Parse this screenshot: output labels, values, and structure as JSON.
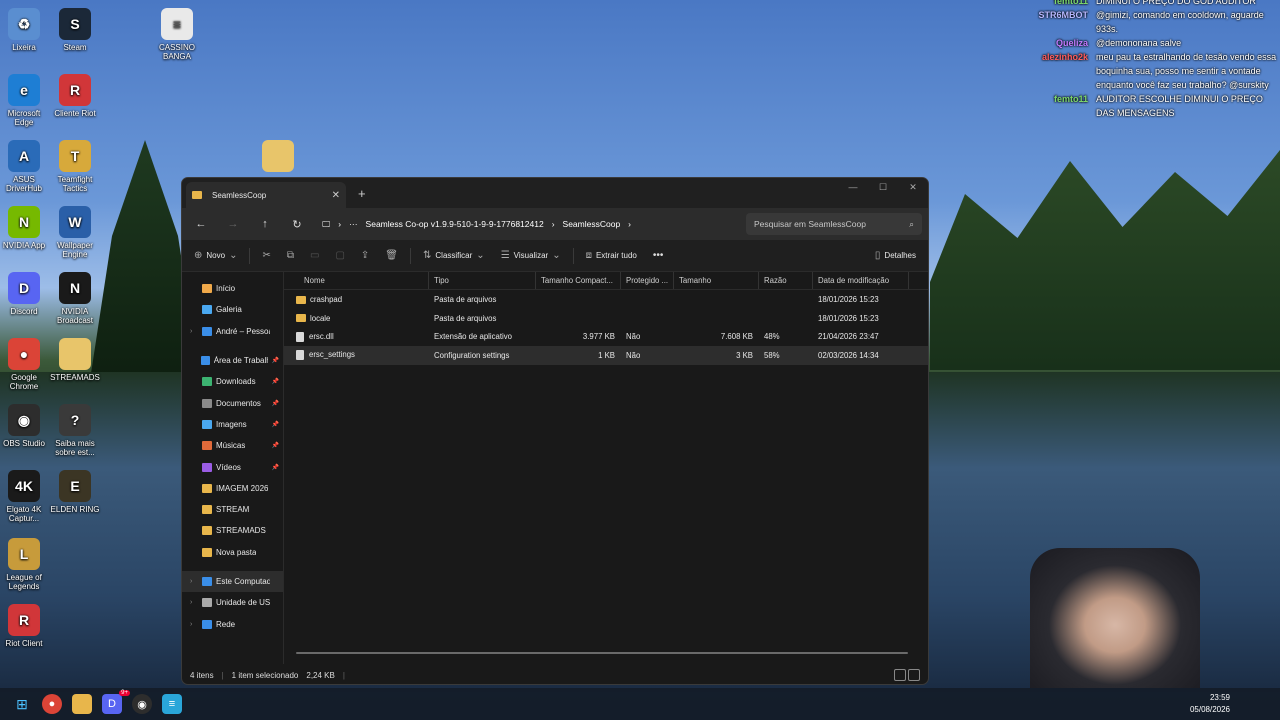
{
  "desktop": {
    "icons": [
      {
        "label": "Lixeira",
        "icon": "recycle-bin-icon",
        "color": "#5a8ed0",
        "glyph": "♻"
      },
      {
        "label": "Steam",
        "icon": "steam-icon",
        "color": "#1b2838",
        "glyph": "S"
      },
      {
        "label": "CASSINO BANGA",
        "icon": "text-file-icon",
        "color": "#e9e9e9",
        "glyph": "≡"
      },
      {
        "label": "Microsoft Edge",
        "icon": "edge-icon",
        "color": "#1e7ed4",
        "glyph": "e"
      },
      {
        "label": "Cliente Riot",
        "icon": "riot-icon",
        "color": "#d13639",
        "glyph": "R"
      },
      {
        "label": "ASUS DriverHub",
        "icon": "asus-icon",
        "color": "#2a6bb8",
        "glyph": "A"
      },
      {
        "label": "Teamfight Tactics",
        "icon": "tft-icon",
        "color": "#d7a93b",
        "glyph": "T"
      },
      {
        "label": "NVIDIA App",
        "icon": "nvidia-icon",
        "color": "#76b900",
        "glyph": "N"
      },
      {
        "label": "Wallpaper Engine",
        "icon": "wallpaper-engine-icon",
        "color": "#2a5fa8",
        "glyph": "W"
      },
      {
        "label": "Discord",
        "icon": "discord-icon",
        "color": "#5865f2",
        "glyph": "D"
      },
      {
        "label": "NVIDIA Broadcast",
        "icon": "nvidia-broadcast-icon",
        "color": "#1a1a1a",
        "glyph": "N"
      },
      {
        "label": "Google Chrome",
        "icon": "chrome-icon",
        "color": "#db4437",
        "glyph": "●"
      },
      {
        "label": "STREAMADS",
        "icon": "folder-icon",
        "color": "#e8c56a",
        "glyph": ""
      },
      {
        "label": "OBS Studio",
        "icon": "obs-icon",
        "color": "#2d2d2d",
        "glyph": "◉"
      },
      {
        "label": "Saiba mais sobre est...",
        "icon": "learn-more-icon",
        "color": "#3a3a3a",
        "glyph": "?"
      },
      {
        "label": "Elgato 4K Captur...",
        "icon": "elgato-icon",
        "color": "#1a1a1a",
        "glyph": "4K"
      },
      {
        "label": "ELDEN RING",
        "icon": "elden-ring-icon",
        "color": "#3b3524",
        "glyph": "E"
      },
      {
        "label": "League of Legends",
        "icon": "league-icon",
        "color": "#c79b3b",
        "glyph": "L"
      },
      {
        "label": "Riot Client",
        "icon": "riot-client-icon",
        "color": "#d13639",
        "glyph": "R"
      }
    ],
    "folder_near_window": "STREAMADS"
  },
  "chat": [
    {
      "user": "femto11",
      "user_color": "#7cd66b",
      "text": "DIMINUI O PREÇO DO GOD AUDITOR"
    },
    {
      "user": "STR6MBOT",
      "user_color": "#b7b7ff",
      "text": "@gimizi, comando em cooldown, aguarde 933s."
    },
    {
      "user": "Queliza",
      "user_color": "#c27aff",
      "text": "@demononana salve"
    },
    {
      "user": "alezinho2k",
      "user_color": "#ff5c5c",
      "text": "meu pau ta estralhando de tesão vendo essa boquinha sua, posso me sentir a vontade enquanto você faz seu trabalho? @surskity"
    },
    {
      "user": "femto11",
      "user_color": "#7cd66b",
      "text": "AUDITOR ESCOLHE DIMINUI O PREÇO DAS MENSAGENS"
    }
  ],
  "explorer": {
    "tab_title": "SeamlessCoop",
    "breadcrumb": [
      "Seamless Co-op v1.9.9-510-1-9-9-1776812412",
      "SeamlessCoop"
    ],
    "search_placeholder": "Pesquisar em SeamlessCoop",
    "commands": {
      "new": "Novo",
      "sort": "Classificar",
      "view": "Visualizar",
      "extract": "Extrair tudo",
      "details": "Detalhes"
    },
    "sidebar": [
      {
        "label": "Início",
        "icon": "home-icon",
        "color": "#f0a94a",
        "chev": false,
        "pin": false
      },
      {
        "label": "Galeria",
        "icon": "gallery-icon",
        "color": "#4aa8f0",
        "chev": false,
        "pin": false
      },
      {
        "label": "André – Pessoal",
        "icon": "onedrive-icon",
        "color": "#3a8ee8",
        "chev": true,
        "pin": false
      },
      {
        "gap": true
      },
      {
        "label": "Área de Trabalho",
        "icon": "desktop-icon",
        "color": "#3a8ee8",
        "chev": false,
        "pin": true
      },
      {
        "label": "Downloads",
        "icon": "downloads-icon",
        "color": "#3cb371",
        "chev": false,
        "pin": true
      },
      {
        "label": "Documentos",
        "icon": "documents-icon",
        "color": "#8a8a8a",
        "chev": false,
        "pin": true
      },
      {
        "label": "Imagens",
        "icon": "images-icon",
        "color": "#4aa8f0",
        "chev": false,
        "pin": true
      },
      {
        "label": "Músicas",
        "icon": "music-icon",
        "color": "#e06a3a",
        "chev": false,
        "pin": true
      },
      {
        "label": "Vídeos",
        "icon": "videos-icon",
        "color": "#9b5de5",
        "chev": false,
        "pin": true
      },
      {
        "label": "IMAGEM 2026",
        "icon": "folder-icon",
        "color": "#e8b64b",
        "chev": false,
        "pin": false
      },
      {
        "label": "STREAM",
        "icon": "folder-icon",
        "color": "#e8b64b",
        "chev": false,
        "pin": false
      },
      {
        "label": "STREAMADS",
        "icon": "folder-icon",
        "color": "#e8b64b",
        "chev": false,
        "pin": false
      },
      {
        "label": "Nova pasta",
        "icon": "folder-icon",
        "color": "#e8b64b",
        "chev": false,
        "pin": false
      },
      {
        "gap": true
      },
      {
        "label": "Este Computador",
        "icon": "computer-icon",
        "color": "#3a8ee8",
        "chev": true,
        "pin": false,
        "selected": true
      },
      {
        "label": "Unidade de USB",
        "icon": "usb-icon",
        "color": "#aaaaaa",
        "chev": true,
        "pin": false
      },
      {
        "label": "Rede",
        "icon": "network-icon",
        "color": "#3a8ee8",
        "chev": true,
        "pin": false
      }
    ],
    "columns": [
      "Nome",
      "Tipo",
      "Tamanho Compact...",
      "Protegido ...",
      "Tamanho",
      "Razão",
      "Data de modificação"
    ],
    "files": [
      {
        "name": "crashpad",
        "kind": "folder",
        "type": "Pasta de arquivos",
        "compressed": "",
        "protected": "",
        "size": "",
        "ratio": "",
        "modified": "18/01/2026 15:23"
      },
      {
        "name": "locale",
        "kind": "folder",
        "type": "Pasta de arquivos",
        "compressed": "",
        "protected": "",
        "size": "",
        "ratio": "",
        "modified": "18/01/2026 15:23"
      },
      {
        "name": "ersc.dll",
        "kind": "file",
        "type": "Extensão de aplicativo",
        "compressed": "3.977 KB",
        "protected": "Não",
        "size": "7.608 KB",
        "ratio": "48%",
        "modified": "21/04/2026 23:47"
      },
      {
        "name": "ersc_settings",
        "kind": "file",
        "type": "Configuration settings",
        "compressed": "1 KB",
        "protected": "Não",
        "size": "3 KB",
        "ratio": "58%",
        "modified": "02/03/2026 14:34",
        "selected": true
      }
    ],
    "status": {
      "count": "4 itens",
      "selection": "1 item selecionado",
      "selection_size": "2,24 KB"
    }
  },
  "taskbar": {
    "time": "23:59",
    "date": "05/08/2026",
    "discord_badge": "9+"
  }
}
